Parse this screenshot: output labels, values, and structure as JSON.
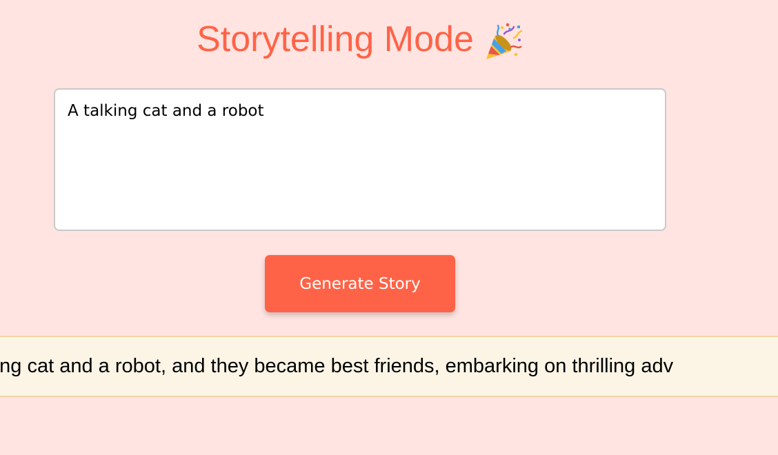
{
  "header": {
    "title": "Storytelling Mode",
    "icon": "party-popper-icon"
  },
  "prompt": {
    "value": "A talking cat and a robot"
  },
  "actions": {
    "generate_label": "Generate Story"
  },
  "story": {
    "visible_text": "me, A talking cat and a robot, and they became best friends, embarking on thrilling adv"
  },
  "colors": {
    "background": "#ffe4e1",
    "accent": "#ff6347",
    "story_background": "#fcf5e6",
    "story_border": "#f4d3a4"
  }
}
